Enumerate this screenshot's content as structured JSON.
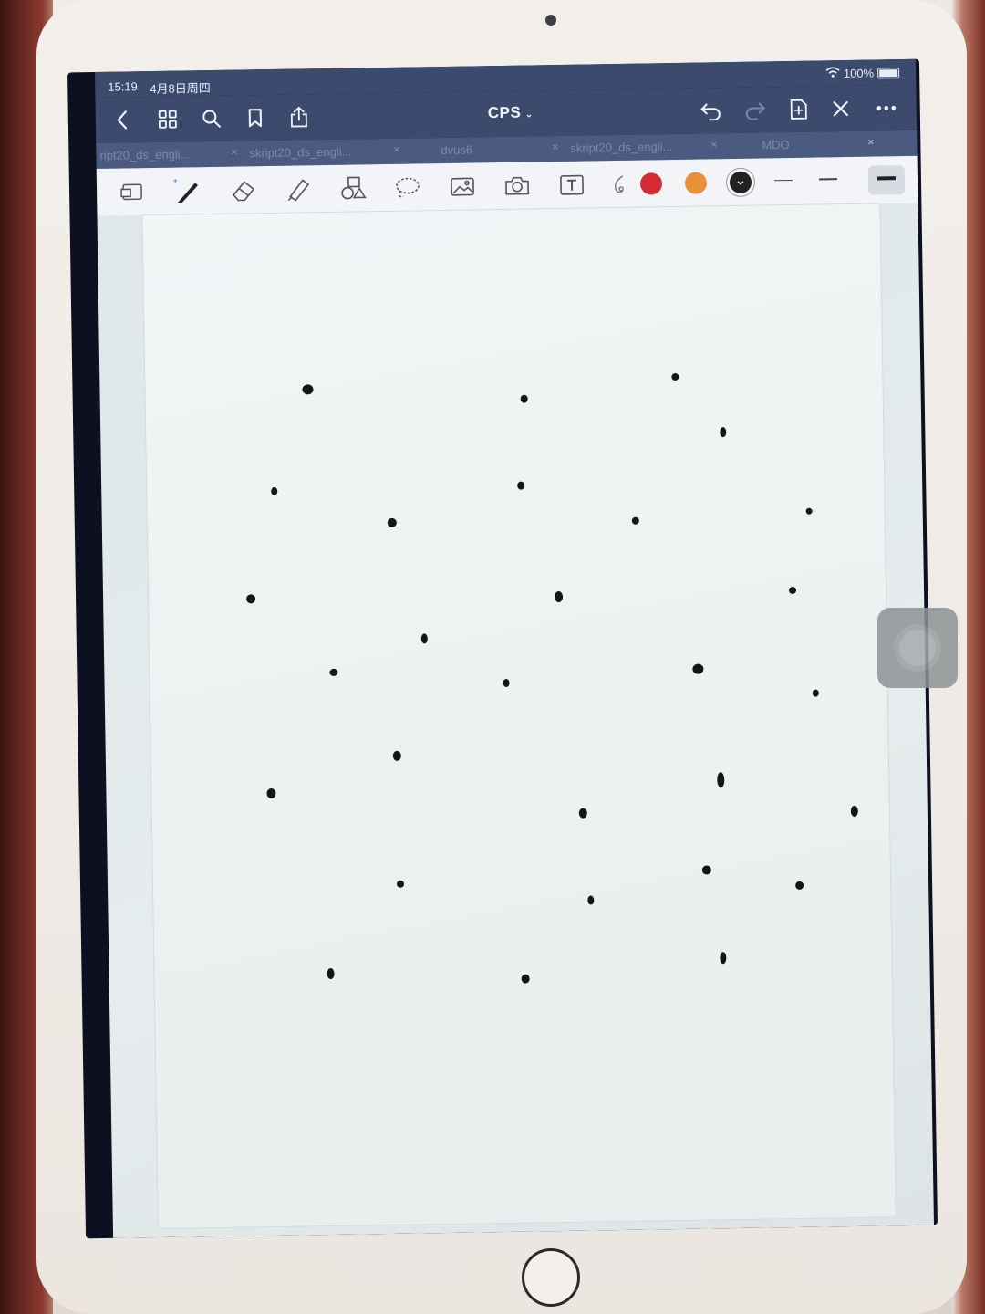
{
  "status_bar": {
    "time": "15:19",
    "date": "4月8日周四",
    "battery": "100%"
  },
  "nav": {
    "title": "CPS",
    "icons": [
      "back-icon",
      "grid-icon",
      "search-icon",
      "bookmark-icon",
      "share-icon",
      "undo-icon",
      "redo-icon",
      "add-page-icon",
      "close-icon",
      "more-icon"
    ]
  },
  "tabs": [
    {
      "label": "ript20_ds_engli..."
    },
    {
      "label": "skript20_ds_engli..."
    },
    {
      "label": "dvus6"
    },
    {
      "label": "skript20_ds_engli..."
    },
    {
      "label": "MDO"
    }
  ],
  "toolbar": {
    "tools": [
      "page-layout-icon",
      "pen-icon",
      "eraser-icon",
      "highlighter-icon",
      "shapes-icon",
      "lasso-icon",
      "image-icon",
      "camera-icon",
      "text-box-icon",
      "laser-icon"
    ],
    "colors": [
      "#d62a35",
      "#e8903a",
      "#222222"
    ],
    "selected_color": "#222222",
    "line_widths": [
      "thin",
      "medium",
      "thick"
    ],
    "selected_line_width": "thick"
  },
  "note": {
    "dot_count": 31
  }
}
